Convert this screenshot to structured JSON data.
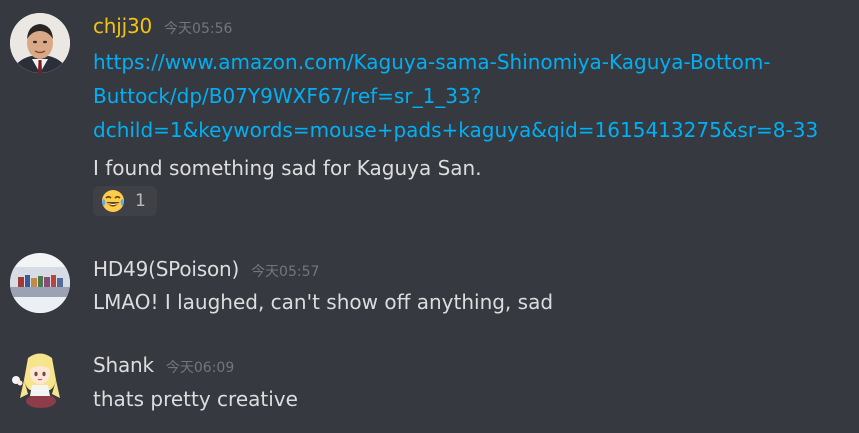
{
  "colors": {
    "background": "#36393f",
    "username_chjj30": "#f1c40f",
    "username_default": "#dcddde",
    "link": "#00b0f4",
    "timestamp": "#72767d"
  },
  "messages": [
    {
      "username": "chjj30",
      "timestamp": "今天05:56",
      "avatar_icon": "man-portrait-avatar",
      "link_lines": [
        "https://www.amazon.com/Kaguya-sama-Shinomiya-Kaguya-Bottom-",
        "Buttock/dp/B07Y9WXF67/ref=sr_1_33?",
        "dchild=1&keywords=mouse+pads+kaguya&qid=1615413275&sr=8-33"
      ],
      "text": "I found something sad for Kaguya San.",
      "reaction": {
        "emoji": "joy-emoji",
        "count": "1"
      }
    },
    {
      "username": "HD49(SPoison)",
      "timestamp": "今天05:57",
      "avatar_icon": "mural-photo-avatar",
      "text": "LMAO! I laughed, can't show off anything, sad"
    },
    {
      "username": "Shank",
      "timestamp": "今天06:09",
      "avatar_icon": "anime-girl-avatar",
      "text": "thats pretty creative"
    }
  ]
}
